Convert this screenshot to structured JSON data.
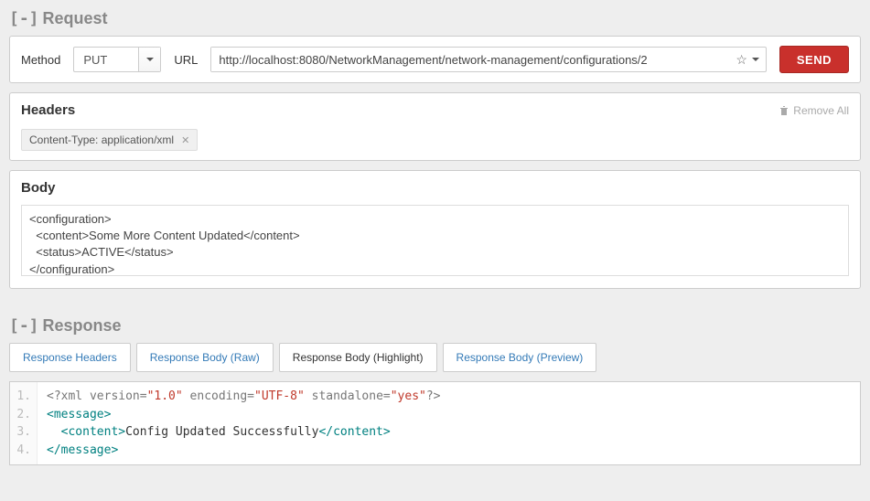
{
  "request": {
    "title": "Request",
    "method_label": "Method",
    "method_value": "PUT",
    "url_label": "URL",
    "url_value": "http://localhost:8080/NetworkManagement/network-management/configurations/2",
    "send_label": "SEND"
  },
  "headers": {
    "title": "Headers",
    "remove_all": "Remove All",
    "items": [
      {
        "text": "Content-Type: application/xml"
      }
    ]
  },
  "body": {
    "title": "Body",
    "content": "<configuration>\n  <content>Some More Content Updated</content>\n  <status>ACTIVE</status>\n</configuration>"
  },
  "response": {
    "title": "Response",
    "tabs": [
      {
        "label": "Response Headers",
        "active": false
      },
      {
        "label": "Response Body (Raw)",
        "active": false
      },
      {
        "label": "Response Body (Highlight)",
        "active": true
      },
      {
        "label": "Response Body (Preview)",
        "active": false
      }
    ],
    "code": {
      "xml_version": "1.0",
      "xml_encoding": "UTF-8",
      "xml_standalone": "yes",
      "message_content": "Config Updated Successfully"
    }
  }
}
